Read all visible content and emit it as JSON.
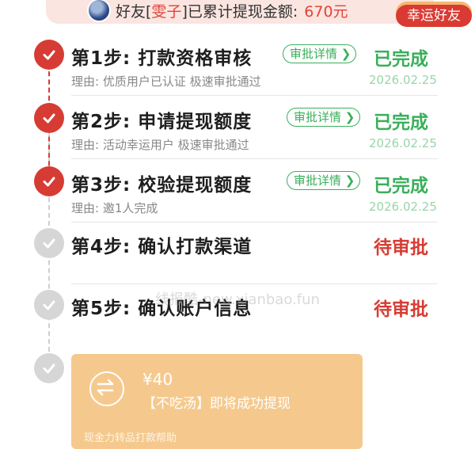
{
  "banner": {
    "prefix": "好友[",
    "name": "雯子",
    "suffix": "]已累计提现金额:",
    "amount": "670元",
    "badge": "幸运好友"
  },
  "steps": [
    {
      "title": "第1步: 打款资格审核",
      "detail": "审批详情",
      "status": "已完成",
      "reason": "理由: 优质用户已认证 极速审批通过",
      "date": "2026.02.25",
      "state": "done"
    },
    {
      "title": "第2步: 申请提现额度",
      "detail": "审批详情",
      "status": "已完成",
      "reason": "理由: 活动幸运用户 极速审批通过",
      "date": "2026.02.25",
      "state": "done"
    },
    {
      "title": "第3步: 校验提现额度",
      "detail": "审批详情",
      "status": "已完成",
      "reason": "理由: 邀1人完成",
      "date": "2026.02.25",
      "state": "done"
    },
    {
      "title": "第4步: 确认打款渠道",
      "status": "待审批",
      "state": "pending"
    },
    {
      "title": "第5步: 确认账户信息",
      "status": "待审批",
      "state": "pending"
    }
  ],
  "watermark": "线报酷-new.xianbao.fun",
  "card": {
    "amount": "¥40",
    "message": "【不吃汤】即将成功提现",
    "footer": "现金力转品打款帮助"
  },
  "colors": {
    "accent_red": "#d63c33",
    "success_green": "#3aaf5b",
    "card": "#f5c98d"
  }
}
